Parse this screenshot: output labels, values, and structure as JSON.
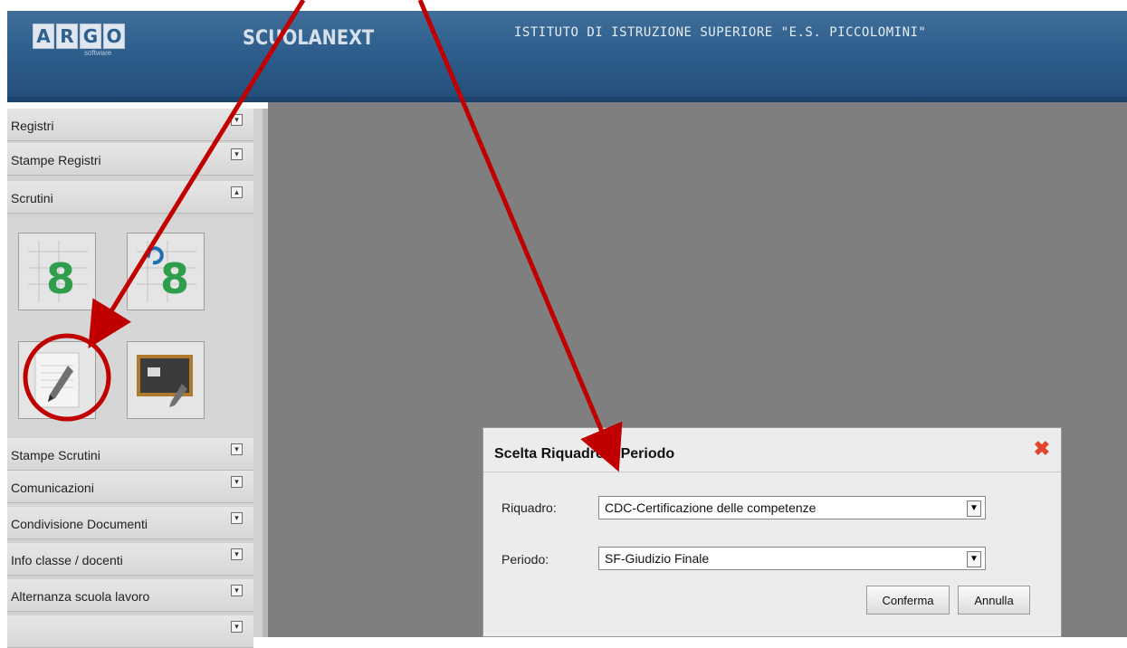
{
  "header": {
    "logo_letters": [
      "A",
      "R",
      "G",
      "O"
    ],
    "logo_sub": "software",
    "app_name": "SCUOLANEXT",
    "school_name": "ISTITUTO DI ISTRUZIONE SUPERIORE \"E.S. PICCOLOMINI\""
  },
  "sidebar": {
    "items": [
      {
        "label": "Registri"
      },
      {
        "label": "Stampe Registri"
      },
      {
        "label": "Scrutini"
      },
      {
        "label": "Stampe Scrutini"
      },
      {
        "label": "Comunicazioni"
      },
      {
        "label": "Condivisione Documenti"
      },
      {
        "label": "Info classe / docenti"
      },
      {
        "label": "Alternanza scuola lavoro"
      }
    ],
    "scrutini_tiles": [
      "grade-entry-icon",
      "grade-refresh-icon",
      "edit-pencil-icon",
      "blackboard-pencil-icon"
    ]
  },
  "dialog": {
    "title": "Scelta Riquadro e Periodo",
    "riquadro_label": "Riquadro:",
    "riquadro_value": "CDC-Certificazione delle competenze",
    "periodo_label": "Periodo:",
    "periodo_value": "SF-Giudizio Finale",
    "confirm_label": "Conferma",
    "cancel_label": "Annulla"
  },
  "colors": {
    "header": "#2f5f8d",
    "annotation": "#c00000",
    "close": "#e0442d"
  }
}
